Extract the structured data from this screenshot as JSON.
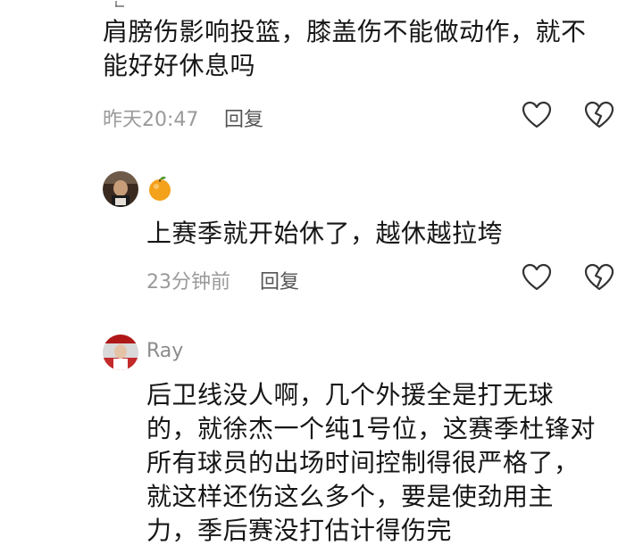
{
  "comments": [
    {
      "text_line1": "肩膀伤影响投篮，膝盖伤不能做动作，就不",
      "text_line2": "能好好休息吗",
      "time": "昨天20:47",
      "reply": "回复"
    },
    {
      "username": "",
      "text": "上赛季就开始休了，越休越拉垮",
      "time": "23分钟前",
      "reply": "回复"
    },
    {
      "username": "Ray",
      "lines": [
        "后卫线没人啊，几个外援全是打无球",
        "的，就徐杰一个纯1号位，这赛季杜锋对",
        "所有球员的出场时间控制得很严格了，",
        "就这样还伤这么多个，要是使劲用主",
        "力，季后赛没打估计得伤完"
      ]
    }
  ],
  "colors": {
    "text": "#161616",
    "meta": "#9a9a9a",
    "icon": "#333333",
    "orange": "#f4a21b"
  },
  "icons": [
    "heart-icon",
    "dislike-heart-icon",
    "orange-emoji-icon"
  ]
}
